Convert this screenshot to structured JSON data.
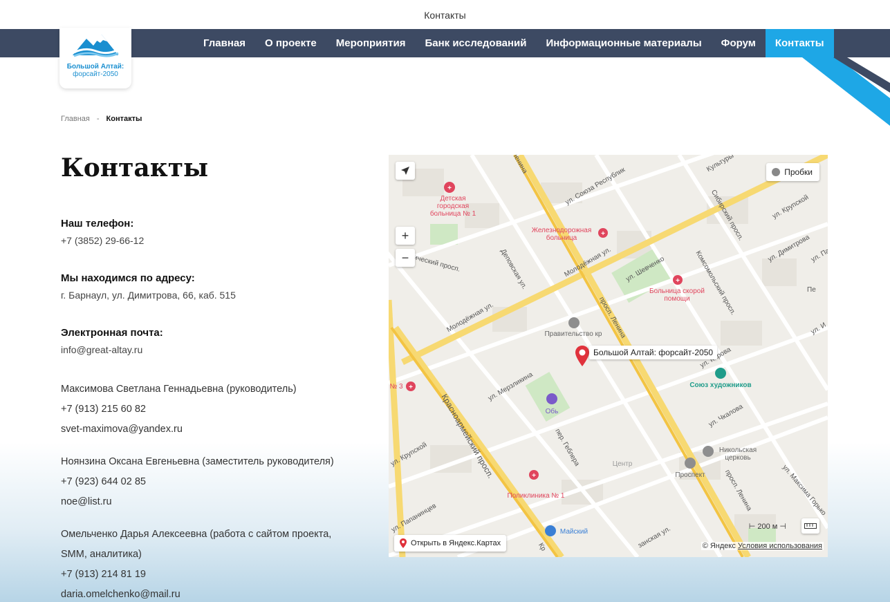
{
  "window": {
    "title": "Контакты"
  },
  "logo": {
    "line1": "Большой Алтай:",
    "line2": "форсайт-2050"
  },
  "nav": {
    "items": [
      "Главная",
      "О проекте",
      "Мероприятия",
      "Банк исследований",
      "Информационные материалы",
      "Форум",
      "Контакты"
    ],
    "active_index": 6
  },
  "breadcrumb": {
    "home": "Главная",
    "separator": "-",
    "current": "Контакты"
  },
  "page_title": "Контакты",
  "contacts": {
    "phone_label": "Наш телефон:",
    "phone": "+7 (3852) 29-66-12",
    "address_label": "Мы находимся по адресу:",
    "address": "г. Барнаул, ул. Димитрова, 66, каб. 515",
    "email_label": "Электронная почта:",
    "email": "info@great-altay.ru",
    "people": [
      {
        "name": "Максимова Светлана Геннадьевна (руководитель)",
        "phone": "+7 (913) 215 60 82",
        "email": "svet-maximova@yandex.ru"
      },
      {
        "name": "Ноянзина Оксана Евгеньевна (заместитель руководителя)",
        "phone": "+7 (923) 644 02 85",
        "email": "noe@list.ru"
      },
      {
        "name_line1": "Омельченко Дарья Алексеевна (работа с сайтом проекта,",
        "name_line2": "SMM, аналитика)",
        "phone": "+7 (913) 214 81 19",
        "email": "daria.omelchenko@mail.ru"
      }
    ]
  },
  "map": {
    "traffic_label": "Пробки",
    "open_label": "Открыть в Яндекс.Картах",
    "copyright": "© Яндекс",
    "terms": "Условия использования",
    "scale": "200 м",
    "pin_label": "Большой Алтай: форсайт-2050",
    "streets": {
      "lenina_top": "Ленина",
      "soyuza": "ул. Союза Республик",
      "kultury": "Культуры",
      "sibirsky": "Сибирский просп.",
      "krupskoy_top": "ул. Крупской",
      "dimitrova": "ул. Димитрова",
      "lapa": "ул. Па",
      "komsomolsky": "Комсомольский просп.",
      "molodezh1": "Молодёжная ул.",
      "molodezh2": "Молодёжная ул.",
      "shevchenko": "ул. Шевченко",
      "depovskaya": "Деповская ул.",
      "socialist": "истический просп.",
      "lenina_mid": "просп. Ленина",
      "kirova": "ул. Кирова",
      "krasnoarm": "Красноармейский просп.",
      "merzlikina": "ул. Мерзликина",
      "chkalova": "ул. Чкалова",
      "krupskoy_left": "ул. Крупской",
      "geblera": "пер. Геблера",
      "papanintsev": "ул. Папанинцев",
      "lenina_low": "просп. Ленина",
      "gorkogo": "ул. Максима Горько",
      "zanskaya": "занская ул.",
      "kr_bottom": "Кр",
      "sotsial_right": "Пе",
      "right_y": "ул. И"
    },
    "pois": {
      "hosp1": "Детская городская больница № 1",
      "rail": "Железнодорожная больница",
      "emerg": "Больница скорой помощи",
      "gov": "Правительство кр",
      "artists": "Союз художников",
      "ob": "Обь",
      "church": "Никольская церковь",
      "centr": "Центр",
      "prospekt": "Проспект",
      "clinic": "Поликлиника № 1",
      "maysky": "Майский",
      "n3": "№ 3"
    }
  },
  "colors": {
    "nav_bg": "#3d4a63",
    "nav_active": "#1ea7e6",
    "brand_blue": "#1a8fd0"
  }
}
